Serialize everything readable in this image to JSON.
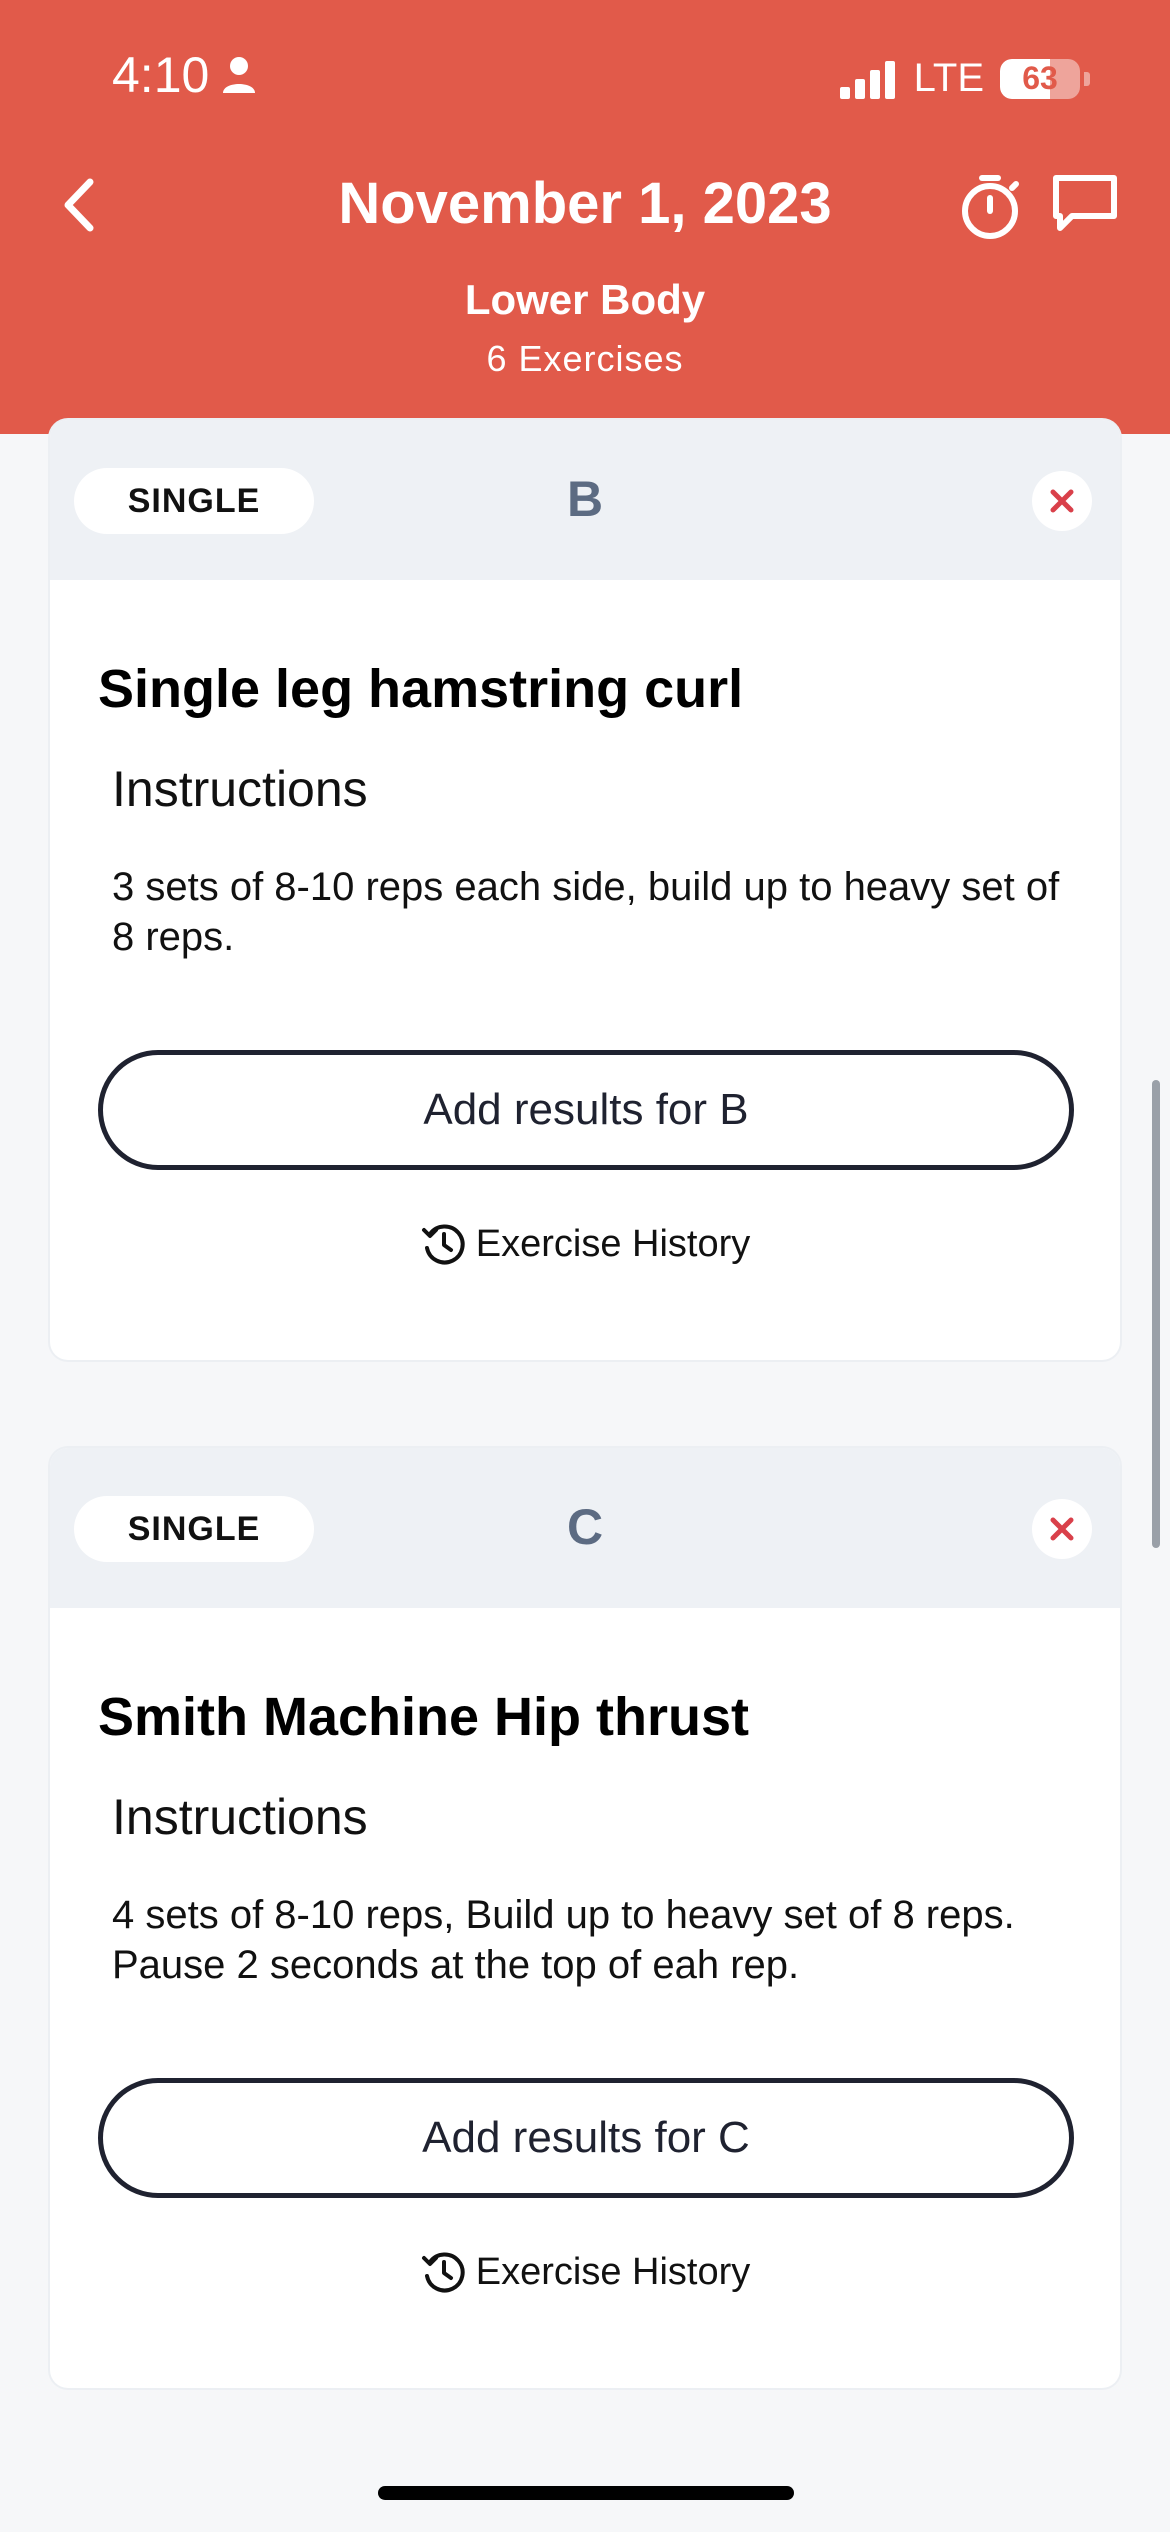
{
  "status_bar": {
    "time": "4:10",
    "network": "LTE",
    "battery_level": "63",
    "battery_fraction": 0.63
  },
  "header": {
    "title": "November 1, 2023",
    "workout_name": "Lower Body",
    "exercise_count": "6 Exercises",
    "background_color": "#e15a4a"
  },
  "cards": [
    {
      "type": "SINGLE",
      "letter": "B",
      "exercise_name": "Single leg hamstring curl",
      "instructions_heading": "Instructions",
      "instructions": "3 sets of 8-10 reps each side, build up to heavy set of 8 reps.",
      "add_button": "Add results for B",
      "history_link": "Exercise History"
    },
    {
      "type": "SINGLE",
      "letter": "C",
      "exercise_name": "Smith Machine Hip thrust",
      "instructions_heading": "Instructions",
      "instructions": "4 sets of 8-10 reps, Build up to heavy set of 8 reps. Pause 2 seconds at the top of eah rep.",
      "add_button": "Add results for C",
      "history_link": "Exercise History"
    }
  ],
  "icons": {
    "back": "chevron-left-icon",
    "timer": "stopwatch-icon",
    "chat": "chat-bubble-icon",
    "close": "close-icon",
    "history": "history-clock-icon"
  }
}
